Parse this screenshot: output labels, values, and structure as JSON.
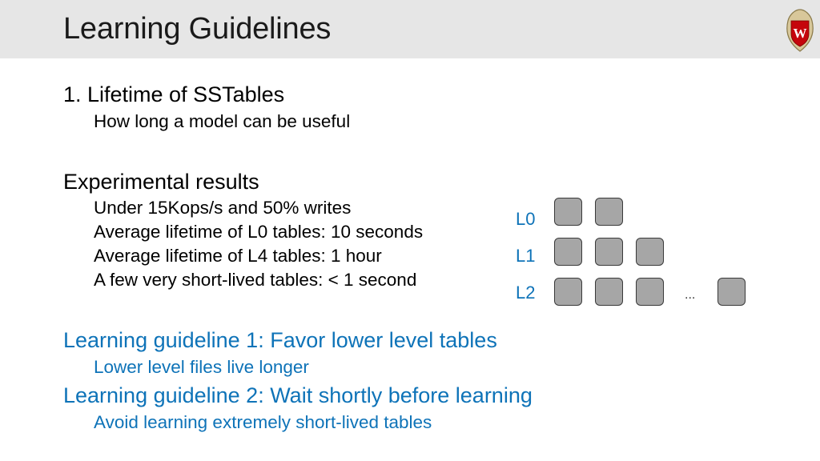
{
  "header": {
    "title": "Learning Guidelines",
    "logo_icon": "uw-crest-icon"
  },
  "section1": {
    "heading": "1. Lifetime of SSTables",
    "subtext": "How long a model can be useful"
  },
  "section2": {
    "heading": "Experimental results",
    "bullets": [
      "Under 15Kops/s and 50% writes",
      "Average lifetime of L0 tables: 10 seconds",
      "Average lifetime of L4 tables: 1 hour",
      "A few very short-lived tables: < 1 second"
    ]
  },
  "diagram": {
    "levels": [
      {
        "label": "L0",
        "tables": 2
      },
      {
        "label": "L1",
        "tables": 3
      },
      {
        "label": "L2",
        "tables": 4
      }
    ],
    "ellipsis": "..."
  },
  "guidelines": [
    {
      "heading": "Learning guideline 1: Favor lower level tables",
      "subtext": "Lower level files live longer"
    },
    {
      "heading": "Learning guideline 2: Wait shortly before learning",
      "subtext": "Avoid learning extremely short-lived tables"
    }
  ],
  "colors": {
    "accent_blue": "#0e73b8",
    "header_bg": "#e6e6e6",
    "table_fill": "#a6a6a6"
  }
}
